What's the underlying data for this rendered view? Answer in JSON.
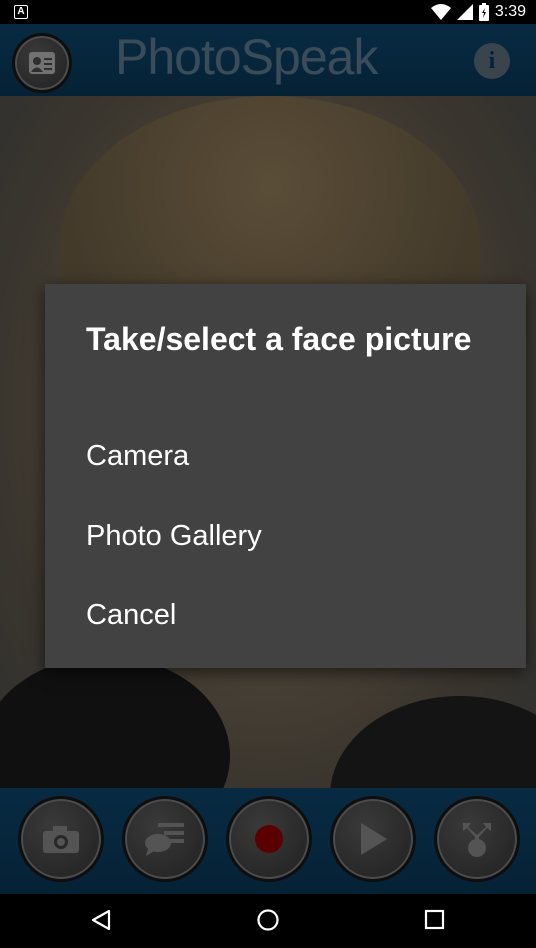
{
  "status_bar": {
    "time": "3:39",
    "notification_icon": "A"
  },
  "app": {
    "title": "PhotoSpeak"
  },
  "dialog": {
    "title": "Take/select a face picture",
    "options": [
      "Camera",
      "Photo Gallery",
      "Cancel"
    ]
  },
  "toolbar": {
    "buttons": [
      "camera-icon",
      "speech-bubble-icon",
      "record-icon",
      "play-icon",
      "share-icon"
    ]
  },
  "colors": {
    "header": "#0e4f7a",
    "dialog_bg": "#424242",
    "record_red": "#a50000"
  }
}
